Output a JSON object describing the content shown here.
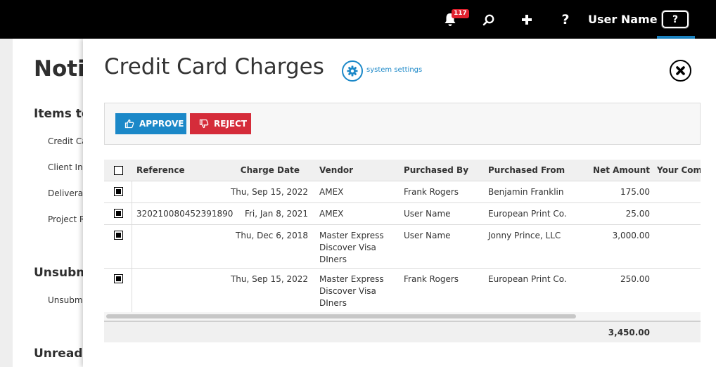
{
  "topbar": {
    "notification_count": "117",
    "help_label": "?",
    "user_name": "User Name",
    "help_box_label": "?"
  },
  "background_page": {
    "title": "Notifi",
    "sections": [
      {
        "heading": "Items to",
        "links": [
          "Credit Ca",
          "Client Inv",
          "Deliverab",
          "Project R"
        ]
      },
      {
        "heading": "Unsubm",
        "links": [
          "Unsubmi"
        ]
      },
      {
        "heading": "Unread",
        "links": []
      }
    ]
  },
  "panel": {
    "title": "Credit Card Charges",
    "settings_link": "system settings",
    "actions": {
      "approve": "APPROVE",
      "reject": "REJECT"
    },
    "table": {
      "columns": [
        "Reference",
        "Charge Date",
        "Vendor",
        "Purchased By",
        "Purchased From",
        "Net Amount",
        "Your Comr"
      ],
      "rows": [
        {
          "reference": "",
          "charge_date": "Thu, Sep 15, 2022",
          "vendor": [
            "AMEX"
          ],
          "purchased_by": "Frank Rogers",
          "purchased_from": "Benjamin Franklin",
          "net_amount": "175.00",
          "checked": true
        },
        {
          "reference": "320210080452391890",
          "charge_date": "Fri, Jan 8, 2021",
          "vendor": [
            "AMEX"
          ],
          "purchased_by": "User Name",
          "purchased_from": "European Print Co.",
          "net_amount": "25.00",
          "checked": true
        },
        {
          "reference": "",
          "charge_date": "Thu, Dec 6, 2018",
          "vendor": [
            "Master Express",
            "Discover Visa",
            "DIners"
          ],
          "purchased_by": "User Name",
          "purchased_from": "Jonny Prince, LLC",
          "net_amount": "3,000.00",
          "checked": true
        },
        {
          "reference": "",
          "charge_date": "Thu, Sep 15, 2022",
          "vendor": [
            "Master Express",
            "Discover Visa",
            "DIners"
          ],
          "purchased_by": "Frank Rogers",
          "purchased_from": "European Print Co.",
          "net_amount": "250.00",
          "checked": true
        }
      ],
      "total": "3,450.00"
    }
  },
  "colors": {
    "accent": "#1b88c8",
    "reject": "#d52c3a",
    "badge": "#e0212e",
    "topbar": "#000000"
  }
}
